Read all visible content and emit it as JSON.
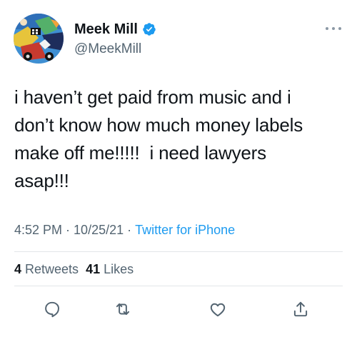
{
  "author": {
    "display_name": "Meek Mill",
    "handle": "@MeekMill",
    "verified": true,
    "avatar_icon": "avatar-image"
  },
  "tweet": {
    "text": "i haven’t get paid from music and i\ndon’t know how much money labels\nmake off me!!!!!  i need lawyers\nasap!!!"
  },
  "meta": {
    "time": "4:52 PM",
    "separator": "·",
    "date": "10/25/21",
    "source": "Twitter for iPhone"
  },
  "stats": {
    "retweets_count": "4",
    "retweets_label": "Retweets",
    "likes_count": "41",
    "likes_label": "Likes"
  },
  "actions": [
    {
      "icon": "reply-icon"
    },
    {
      "icon": "retweet-icon"
    },
    {
      "icon": "like-icon"
    },
    {
      "icon": "share-icon"
    }
  ],
  "colors": {
    "text_primary": "#0f1419",
    "text_secondary": "#536471",
    "link_blue": "#1d9bf0",
    "verified_blue": "#1d9bf0",
    "divider": "#e3e6e8"
  }
}
